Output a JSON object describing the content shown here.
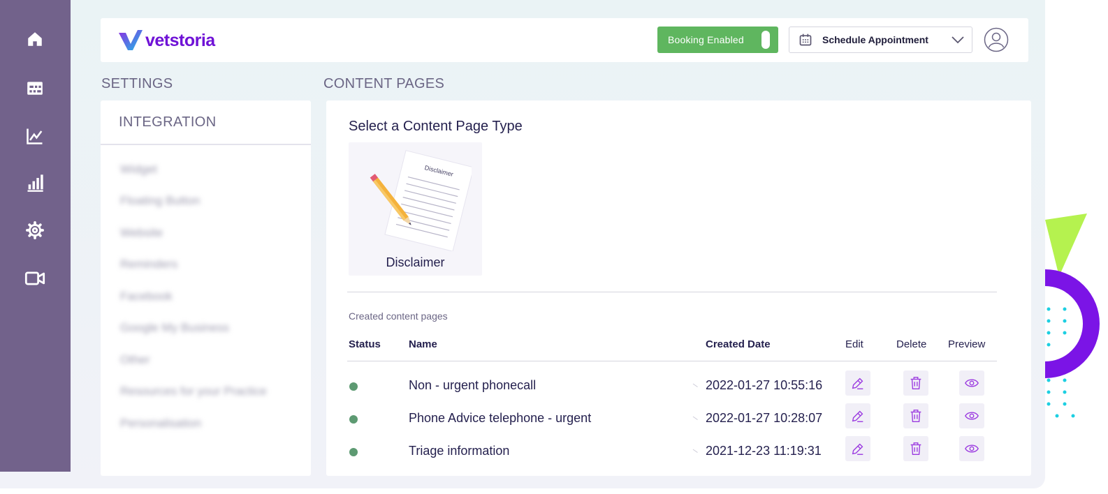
{
  "brand": {
    "name": "vetstoria",
    "accent": "#6f12d6",
    "nav_bg": "#72628b",
    "booking_green": "#5fb65f"
  },
  "nav": {
    "items": [
      {
        "icon": "home-icon"
      },
      {
        "icon": "calendar-grid-icon"
      },
      {
        "icon": "line-chart-icon"
      },
      {
        "icon": "bar-chart-icon"
      },
      {
        "icon": "gear-icon"
      },
      {
        "icon": "video-camera-icon"
      }
    ]
  },
  "header": {
    "booking_label": "Booking Enabled",
    "schedule_label": "Schedule Appointment"
  },
  "settings": {
    "section_title": "SETTINGS",
    "panel_title": "INTEGRATION",
    "items": [
      "Widget",
      "Floating Button",
      "Website",
      "Reminders",
      "Facebook",
      "Google My Business",
      "Other",
      "Resources for your Practice",
      "Personalisation"
    ]
  },
  "content": {
    "section_title": "CONTENT PAGES",
    "select_title": "Select a Content Page Type",
    "card": {
      "label": "Disclaimer",
      "paper_text": "Disclaimer"
    },
    "created_label": "Created content pages",
    "columns": {
      "status": "Status",
      "name": "Name",
      "created": "Created Date",
      "edit": "Edit",
      "delete": "Delete",
      "preview": "Preview"
    },
    "rows": [
      {
        "status_color": "#5d9a72",
        "name": "Non - urgent phonecall",
        "created": "2022-01-27 10:55:16"
      },
      {
        "status_color": "#5d9a72",
        "name": "Phone Advice telephone - urgent",
        "created": "2022-01-27 10:28:07"
      },
      {
        "status_color": "#5d9a72",
        "name": "Triage information",
        "created": "2021-12-23 11:19:31"
      }
    ]
  }
}
